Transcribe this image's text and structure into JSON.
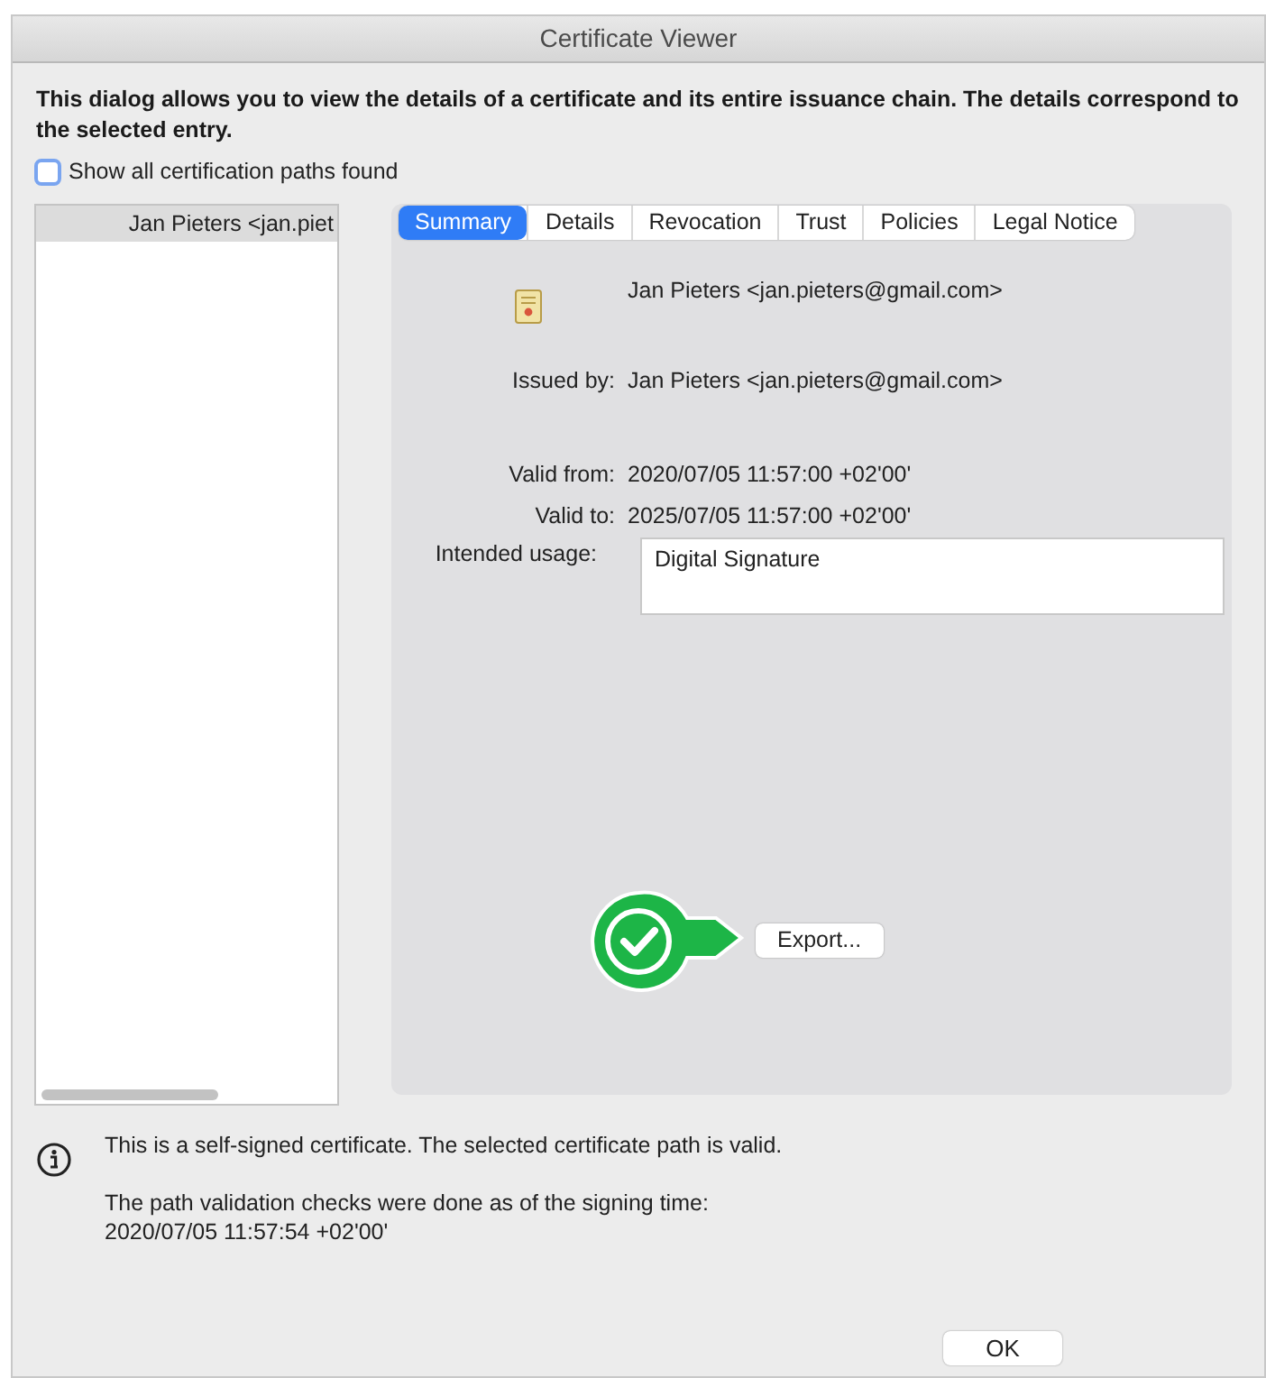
{
  "window": {
    "title": "Certificate Viewer"
  },
  "intro": "This dialog allows you to view the details of a certificate and its entire issuance chain. The details correspond to the selected entry.",
  "show_all_paths": {
    "label": "Show all certification paths found",
    "checked": false
  },
  "chain": [
    {
      "label": "Jan Pieters <jan.piet",
      "selected": true
    }
  ],
  "tabs": [
    {
      "label": "Summary",
      "selected": true
    },
    {
      "label": "Details",
      "selected": false
    },
    {
      "label": "Revocation",
      "selected": false
    },
    {
      "label": "Trust",
      "selected": false
    },
    {
      "label": "Policies",
      "selected": false
    },
    {
      "label": "Legal Notice",
      "selected": false
    }
  ],
  "summary": {
    "subject": "Jan Pieters <jan.pieters@gmail.com>",
    "fields": [
      {
        "label": "Issued by:",
        "value": "Jan Pieters <jan.pieters@gmail.com>"
      },
      {
        "label": "Valid from:",
        "value": "2020/07/05 11:57:00 +02'00'"
      },
      {
        "label": "Valid to:",
        "value": "2025/07/05 11:57:00 +02'00'"
      }
    ],
    "usage_label": "Intended usage:",
    "usage": [
      "Digital Signature"
    ],
    "export_button": "Export..."
  },
  "status": {
    "message": "This is a self-signed certificate. The selected certificate path is valid.",
    "note": "The path validation checks were done as of the signing time:",
    "time": "2020/07/05 11:57:54 +02'00'"
  },
  "ok_button": "OK"
}
